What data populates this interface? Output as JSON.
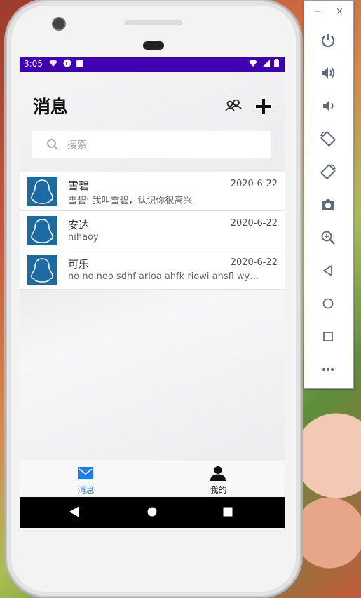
{
  "status_bar": {
    "time": "3:05"
  },
  "header": {
    "title": "消息"
  },
  "search": {
    "placeholder": "搜索"
  },
  "conversations": [
    {
      "name": "雪碧",
      "date": "2020-6-22",
      "preview": "雪碧: 我叫雪碧，认识你很高兴"
    },
    {
      "name": "安达",
      "date": "2020-6-22",
      "preview": "nihaoy"
    },
    {
      "name": "可乐",
      "date": "2020-6-22",
      "preview": "no no noo sdhf arioa ahfk riowi ahsfl wyer..."
    }
  ],
  "tabs": [
    {
      "label": "消息",
      "icon": "envelope-icon",
      "active": true
    },
    {
      "label": "我的",
      "icon": "person-icon",
      "active": false
    }
  ],
  "emulator_toolbar": {
    "window_controls": [
      "−",
      "×"
    ],
    "tools": [
      "power-icon",
      "volume-up-icon",
      "volume-down-icon",
      "rotate-left-icon",
      "rotate-right-icon",
      "camera-icon",
      "zoom-icon",
      "back-icon",
      "home-icon",
      "overview-icon",
      "more-icon"
    ]
  },
  "colors": {
    "status_bar": "#3f00b4",
    "accent_blue": "#1e7cf0",
    "avatar_bg": "#1c6ba3"
  }
}
